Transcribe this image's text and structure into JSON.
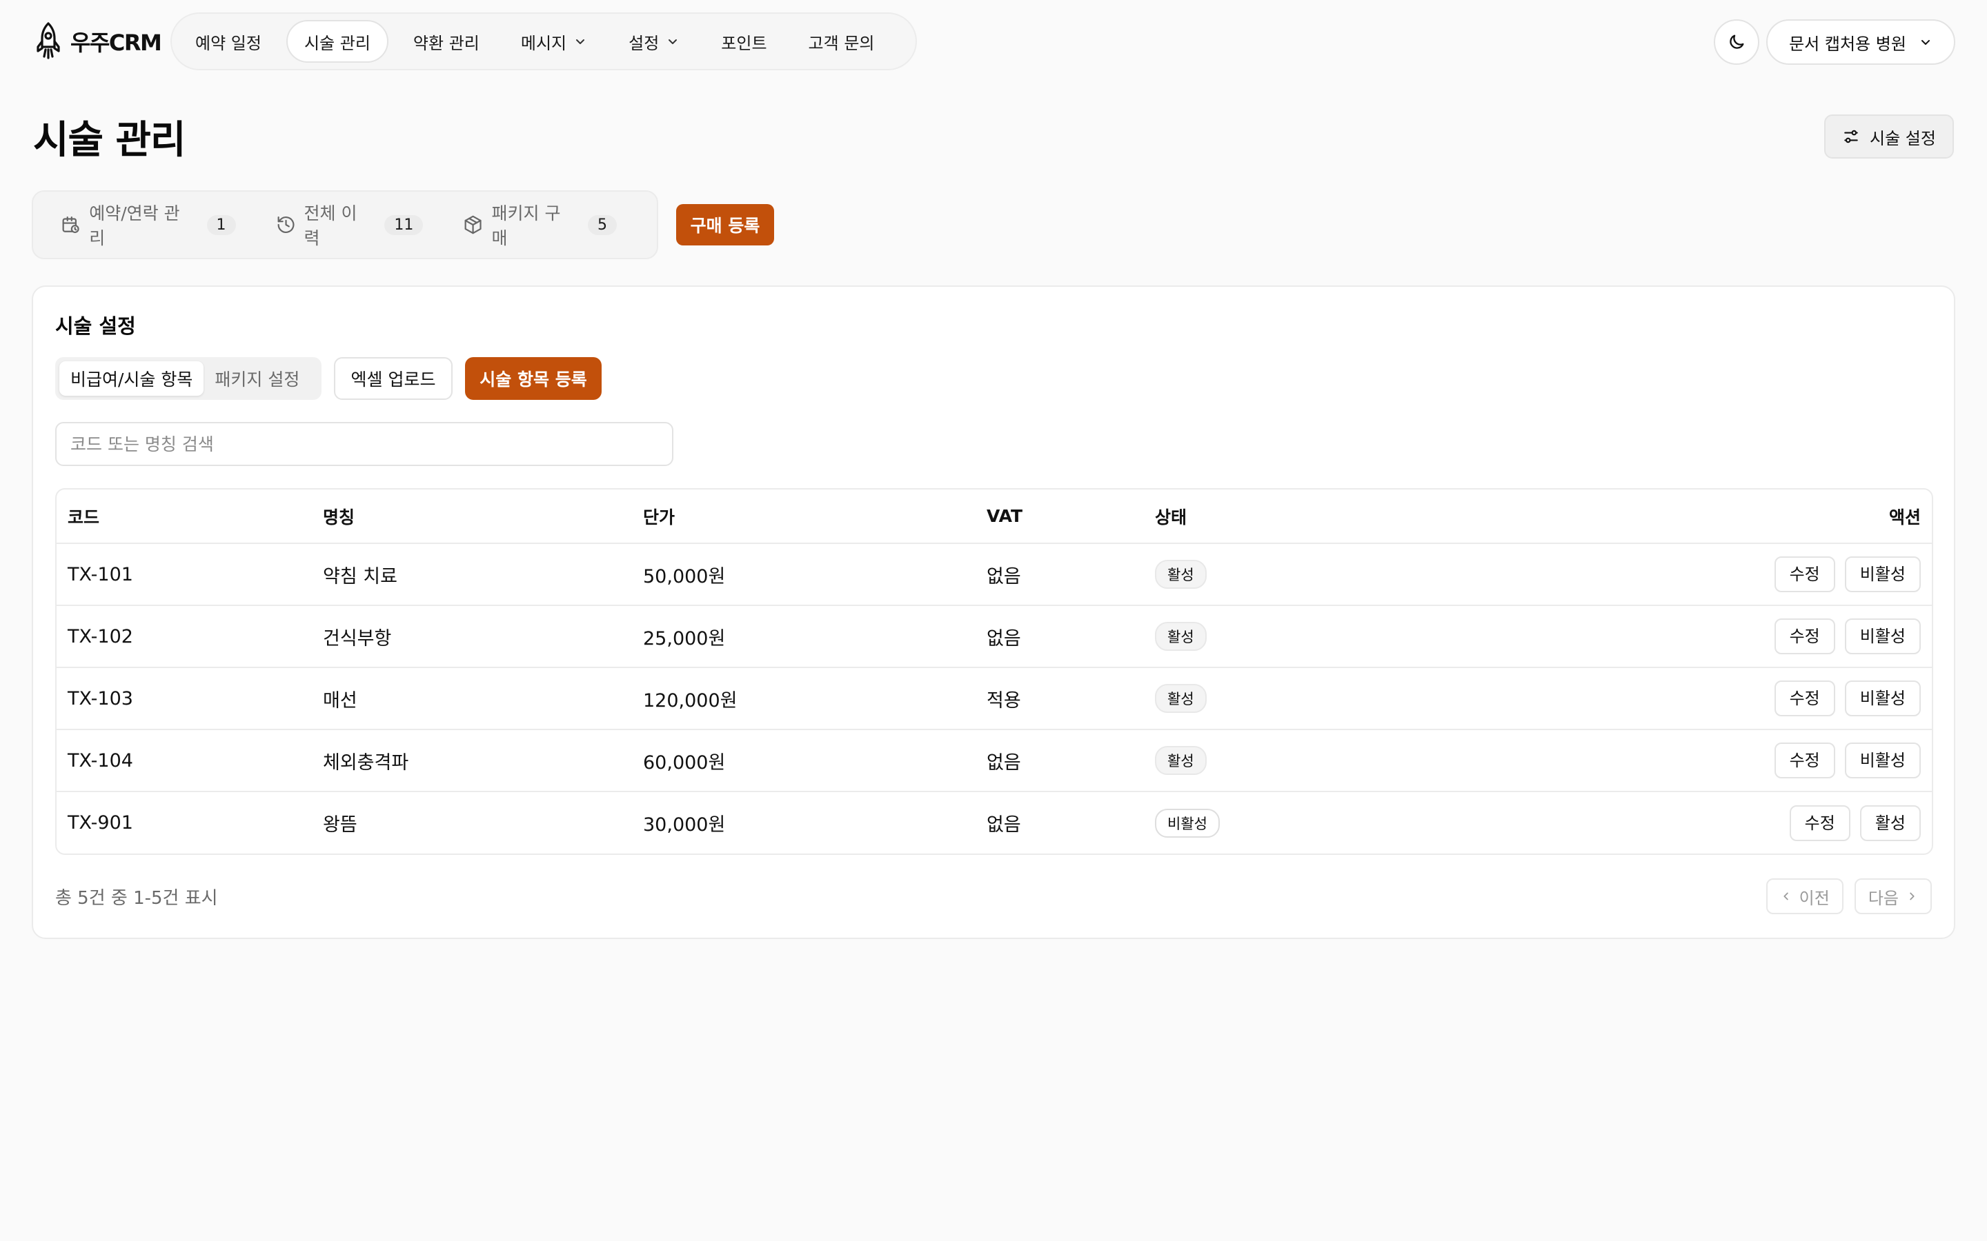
{
  "app": {
    "name": "우주CRM"
  },
  "nav": {
    "items": [
      {
        "label": "예약 일정"
      },
      {
        "label": "시술 관리"
      },
      {
        "label": "약환 관리"
      },
      {
        "label": "메시지"
      },
      {
        "label": "설정"
      },
      {
        "label": "포인트"
      },
      {
        "label": "고객 문의"
      }
    ],
    "active_index": 1
  },
  "header": {
    "clinic_name": "문서 캡처용 병원"
  },
  "page": {
    "title": "시술 관리",
    "settings_button": "시술 설정"
  },
  "summary": {
    "items": [
      {
        "label": "예약/연락 관리",
        "count": "1",
        "icon": "calendar-clock-icon"
      },
      {
        "label": "전체 이력",
        "count": "11",
        "icon": "history-icon"
      },
      {
        "label": "패키지 구매",
        "count": "5",
        "icon": "package-icon"
      }
    ],
    "buy_button": "구매 등록"
  },
  "settings_card": {
    "title": "시술 설정",
    "tabs": [
      {
        "label": "비급여/시술 항목"
      },
      {
        "label": "패키지 설정"
      }
    ],
    "excel_button": "엑셀 업로드",
    "add_button": "시술 항목 등록",
    "search_placeholder": "코드 또는 명칭 검색",
    "table": {
      "columns": {
        "code": "코드",
        "name": "명칭",
        "price": "단가",
        "vat": "VAT",
        "status": "상태",
        "actions": "액션"
      },
      "rows": [
        {
          "code": "TX-101",
          "name": "약침 치료",
          "price": "50,000원",
          "vat": "없음",
          "status": "활성",
          "edit": "수정",
          "toggle": "비활성"
        },
        {
          "code": "TX-102",
          "name": "건식부항",
          "price": "25,000원",
          "vat": "없음",
          "status": "활성",
          "edit": "수정",
          "toggle": "비활성"
        },
        {
          "code": "TX-103",
          "name": "매선",
          "price": "120,000원",
          "vat": "적용",
          "status": "활성",
          "edit": "수정",
          "toggle": "비활성"
        },
        {
          "code": "TX-104",
          "name": "체외충격파",
          "price": "60,000원",
          "vat": "없음",
          "status": "활성",
          "edit": "수정",
          "toggle": "비활성"
        },
        {
          "code": "TX-901",
          "name": "왕뜸",
          "price": "30,000원",
          "vat": "없음",
          "status": "비활성",
          "edit": "수정",
          "toggle": "활성"
        }
      ]
    },
    "footer_text": "총 5건 중 1-5건 표시",
    "prev_label": "이전",
    "next_label": "다음"
  },
  "colors": {
    "accent": "#c2500b",
    "background": "#fafafa"
  }
}
